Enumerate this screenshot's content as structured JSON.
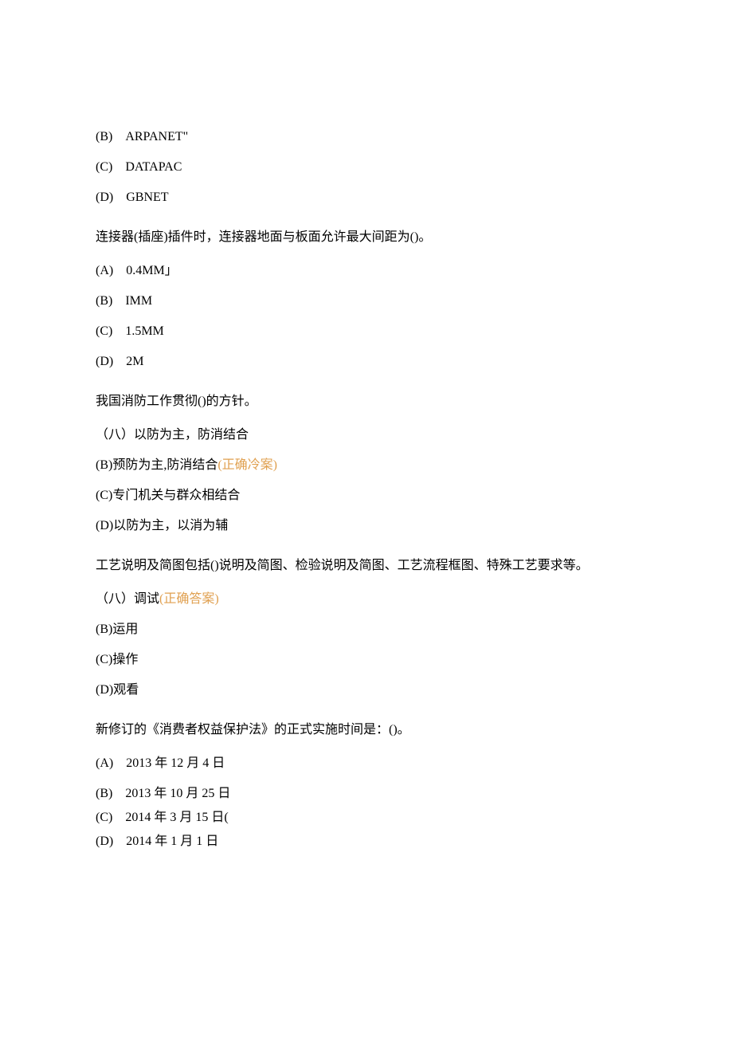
{
  "q1": {
    "optB": "(B)　ARPANET\"",
    "optC": "(C)　DATAPAC",
    "optD": "(D)　GBNET"
  },
  "q2": {
    "stem": "连接器(插座)插件时，连接器地面与板面允许最大间距为()。",
    "optA": "(A)　0.4MM」",
    "optB": "(B)　IMM",
    "optC": "(C)　1.5MM",
    "optD": "(D)　2M"
  },
  "q3": {
    "stem": "我国消防工作贯彻()的方针。",
    "optA": "（八）以防为主，防消结合",
    "optB_text": "(B)预防为主,防消结合",
    "optB_ans": "(正确冷案)",
    "optC": "(C)专门机关与群众相结合",
    "optD": "(D)以防为主，以消为辅"
  },
  "q4": {
    "stem": "工艺说明及简图包括()说明及简图、检验说明及简图、工艺流程框图、特殊工艺要求等。",
    "optA_text": "（八）调试",
    "optA_ans": "(正确答案)",
    "optB": "(B)运用",
    "optC": "(C)操作",
    "optD": "(D)观看"
  },
  "q5": {
    "stem": "新修订的《消费者权益保护法》的正式实施时间是：()。",
    "optA": "(A)　2013 年 12 月 4 日",
    "optB": "(B)　2013 年 10 月 25 日",
    "optC": "(C)　2014 年 3 月 15 日(",
    "optD": "(D)　2014 年 1 月 1 日"
  }
}
